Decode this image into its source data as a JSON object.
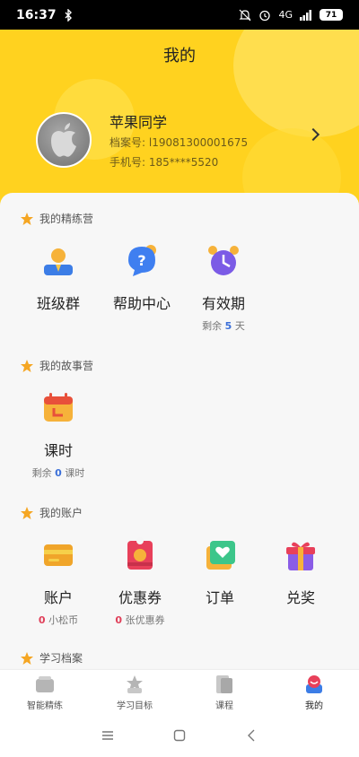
{
  "status_bar": {
    "time": "16:37",
    "battery": "71",
    "signal_label": "4G"
  },
  "header": {
    "title": "我的",
    "user": {
      "name": "苹果同学",
      "file_label": "档案号: ",
      "file_no": "l19081300001675",
      "phone_label": "手机号: ",
      "phone": "185****5520"
    }
  },
  "sections": {
    "camp": {
      "title": "我的精练营",
      "items": [
        {
          "label": "班级群"
        },
        {
          "label": "帮助中心"
        },
        {
          "label": "有效期",
          "sub_prefix": "剩余",
          "sub_value": "5",
          "sub_suffix": "天"
        }
      ]
    },
    "story": {
      "title": "我的故事营",
      "items": [
        {
          "label": "课时",
          "sub_prefix": "剩余",
          "sub_value": "0",
          "sub_suffix": "课时"
        }
      ]
    },
    "account": {
      "title": "我的账户",
      "items": [
        {
          "label": "账户",
          "sub_value": "0",
          "sub_suffix": "小松币"
        },
        {
          "label": "优惠券",
          "sub_value": "0",
          "sub_suffix": "张优惠券"
        },
        {
          "label": "订单"
        },
        {
          "label": "兑奖"
        }
      ]
    },
    "archive": {
      "title": "学习档案"
    }
  },
  "tabbar": {
    "tabs": [
      {
        "label": "智能精练",
        "active": false
      },
      {
        "label": "学习目标",
        "active": false
      },
      {
        "label": "课程",
        "active": false
      },
      {
        "label": "我的",
        "active": true
      }
    ]
  },
  "colors": {
    "brand_yellow": "#ffd21f",
    "star": "#f5a623",
    "blue_number": "#3b6fd8",
    "red_number": "#e0405a"
  }
}
